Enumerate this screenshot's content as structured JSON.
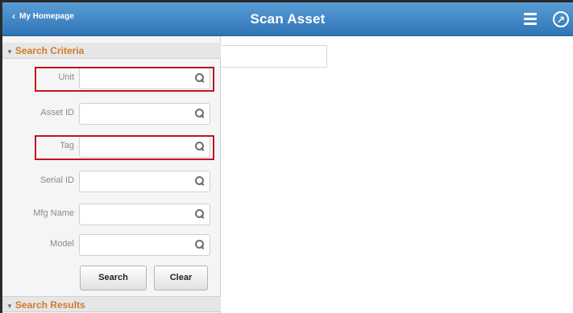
{
  "header": {
    "back_label": "My Homepage",
    "title": "Scan Asset",
    "menu_icon": "hamburger-menu-icon",
    "nav_icon": "navbar-compass-icon"
  },
  "criteria": {
    "header_label": "Search Criteria",
    "fields": [
      {
        "label": "Unit",
        "value": "",
        "highlighted": true
      },
      {
        "label": "Asset ID",
        "value": "",
        "highlighted": false
      },
      {
        "label": "Tag",
        "value": "",
        "highlighted": true
      },
      {
        "label": "Serial ID",
        "value": "",
        "highlighted": false
      },
      {
        "label": "Mfg Name",
        "value": "",
        "highlighted": false
      },
      {
        "label": "Model",
        "value": "",
        "highlighted": false
      }
    ],
    "search_label": "Search",
    "clear_label": "Clear"
  },
  "results": {
    "header_label": "Search Results"
  },
  "colors": {
    "header_bg": "#2f74b5",
    "section_text": "#d27a2a",
    "highlight_border": "#c0161f"
  }
}
